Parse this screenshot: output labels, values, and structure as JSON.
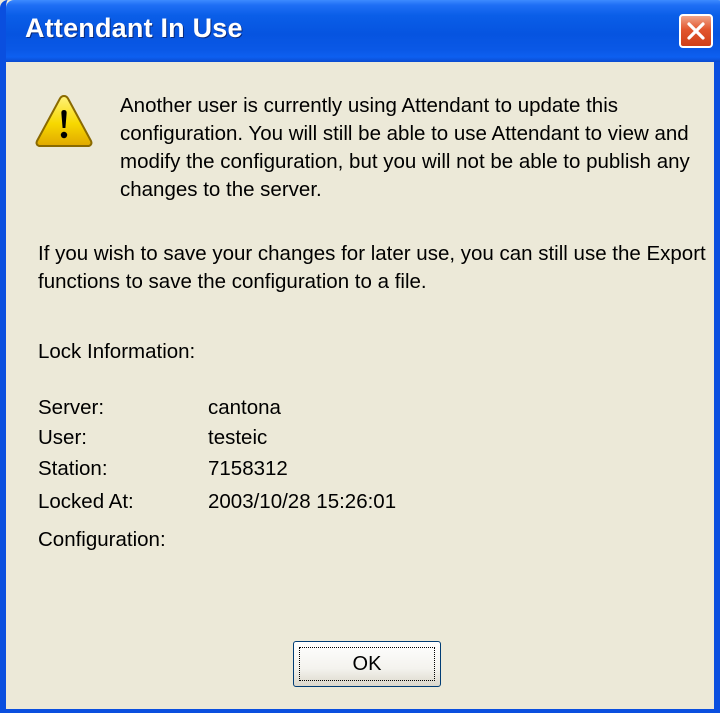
{
  "window": {
    "title": "Attendant In Use"
  },
  "icons": {
    "close": "close-icon",
    "warning": "warning-icon"
  },
  "colors": {
    "titlebar": "#0a58e6",
    "close_button": "#e2562e",
    "window_background": "#ece9d8",
    "warning_yellow": "#f5d400"
  },
  "message": {
    "paragraph1": "Another user is currently using Attendant to update this configuration.  You will still be able to use Attendant to view and modify the configuration, but you will not be able to publish any changes to the server.",
    "paragraph2": "If you wish to save your changes for later use, you can still use the Export functions to save the configuration to a file."
  },
  "lock_info": {
    "heading": "Lock Information:",
    "rows": [
      {
        "label": "Server:",
        "value": "cantona"
      },
      {
        "label": "User:",
        "value": "testeic"
      },
      {
        "label": "Station:",
        "value": "7158312"
      },
      {
        "label": "Locked At:",
        "value": "2003/10/28 15:26:01"
      },
      {
        "label": "Configuration:",
        "value": ""
      }
    ]
  },
  "buttons": {
    "ok_label": "OK"
  }
}
